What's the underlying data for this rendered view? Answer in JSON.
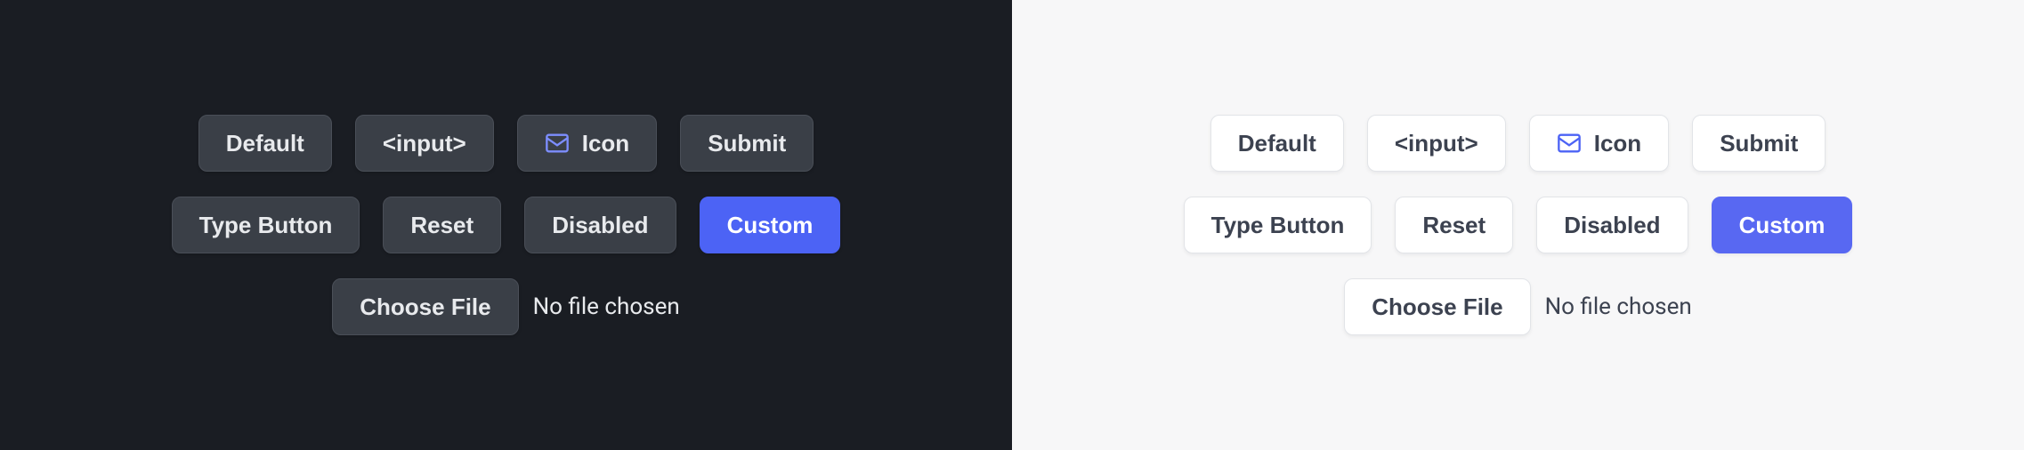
{
  "buttons": {
    "default": "Default",
    "input": "<input>",
    "icon": "Icon",
    "submit": "Submit",
    "type_button": "Type Button",
    "reset": "Reset",
    "disabled": "Disabled",
    "custom": "Custom",
    "choose_file": "Choose File"
  },
  "file": {
    "status": "No file chosen"
  },
  "colors": {
    "dark_bg": "#1a1d23",
    "light_bg": "#f7f7f8",
    "dark_btn": "#3a3f47",
    "light_btn": "#ffffff",
    "primary": "#4c63f5",
    "icon_accent_dark": "#7d8eff",
    "icon_accent_light": "#4c63f5"
  }
}
